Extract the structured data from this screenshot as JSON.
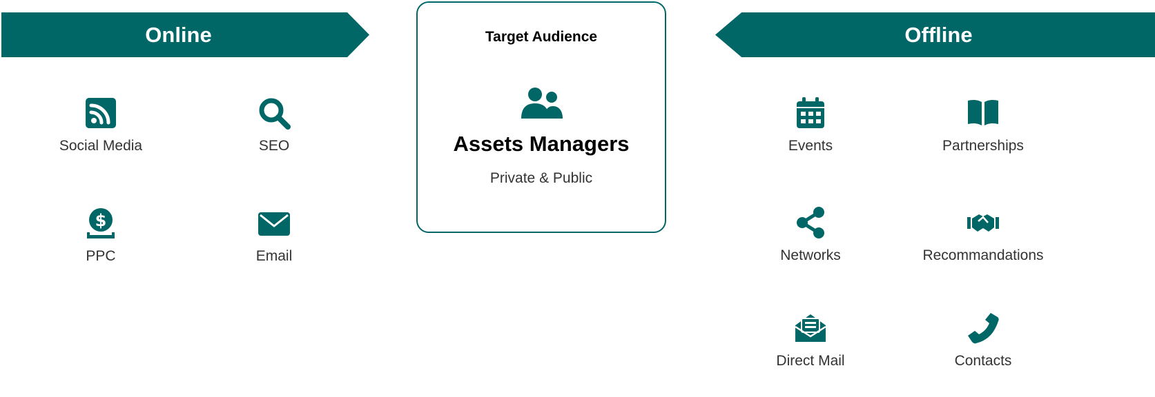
{
  "online": {
    "title": "Online",
    "items": [
      {
        "label": "Social Media",
        "icon": "rss-icon"
      },
      {
        "label": "SEO",
        "icon": "search-icon"
      },
      {
        "label": "PPC",
        "icon": "dollar-coin-icon"
      },
      {
        "label": "Email",
        "icon": "envelope-icon"
      }
    ]
  },
  "target": {
    "label": "Target Audience",
    "title": "Assets Managers",
    "subtitle": "Private & Public",
    "icon": "users-icon"
  },
  "offline": {
    "title": "Offline",
    "items": [
      {
        "label": "Events",
        "icon": "calendar-icon"
      },
      {
        "label": "Partnerships",
        "icon": "book-icon"
      },
      {
        "label": "Networks",
        "icon": "share-icon"
      },
      {
        "label": "Recommandations",
        "icon": "handshake-icon"
      },
      {
        "label": "Direct Mail",
        "icon": "mail-open-icon"
      },
      {
        "label": "Contacts",
        "icon": "phone-icon"
      }
    ]
  },
  "colors": {
    "accent": "#006666",
    "text": "#333333"
  }
}
